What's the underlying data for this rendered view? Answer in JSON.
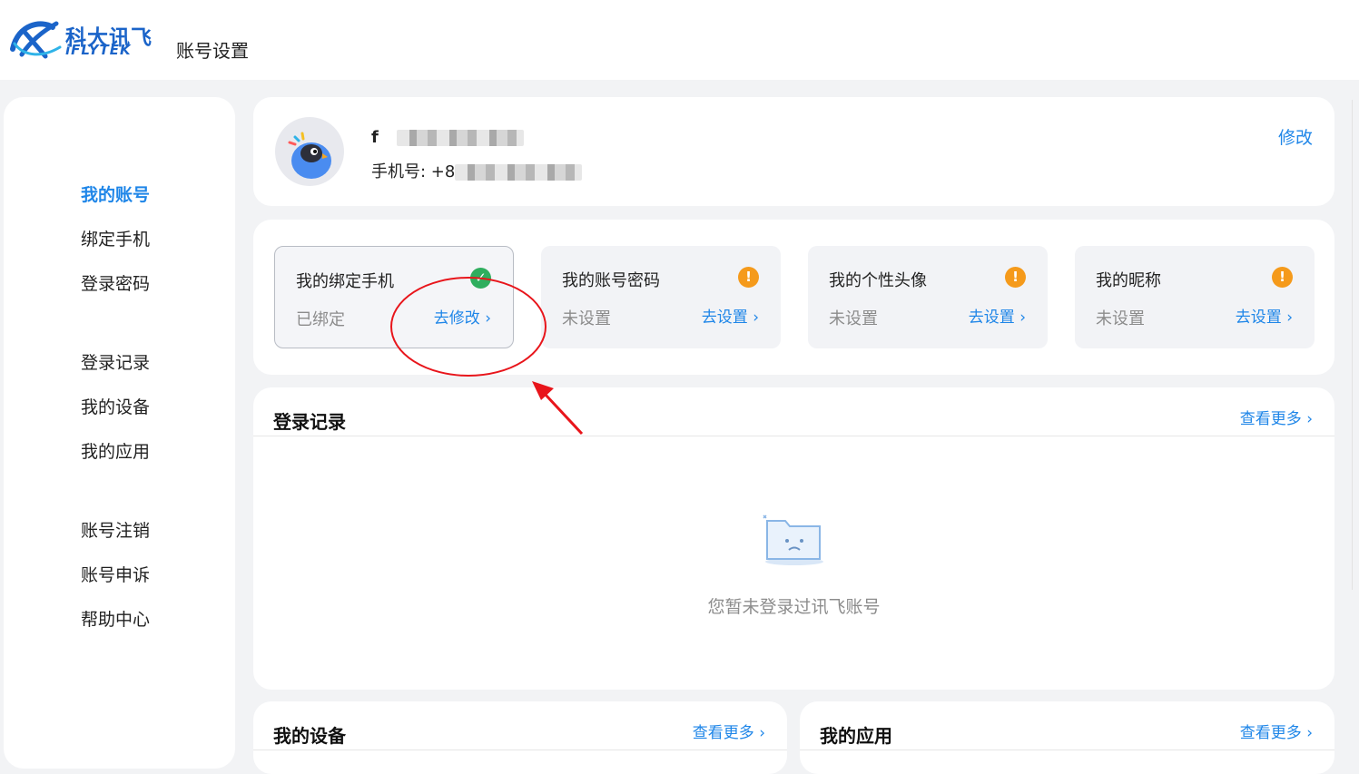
{
  "header": {
    "logo_cn": "科大讯飞",
    "logo_en": "iFLYTEK",
    "title": "账号设置"
  },
  "sidebar": {
    "items": [
      {
        "label": "我的账号",
        "active": true
      },
      {
        "label": "绑定手机"
      },
      {
        "label": "登录密码"
      },
      {
        "label": "登录记录"
      },
      {
        "label": "我的设备"
      },
      {
        "label": "我的应用"
      },
      {
        "label": "账号注销"
      },
      {
        "label": "账号申诉"
      },
      {
        "label": "帮助中心"
      }
    ]
  },
  "profile": {
    "name_prefix": "f",
    "phone_label": "手机号: +8",
    "edit_label": "修改"
  },
  "bindings": [
    {
      "title": "我的绑定手机",
      "status": "已绑定",
      "action": "去修改 ›",
      "state": "ok",
      "icon": "check-icon"
    },
    {
      "title": "我的账号密码",
      "status": "未设置",
      "action": "去设置 ›",
      "state": "warn",
      "icon": "warning-icon"
    },
    {
      "title": "我的个性头像",
      "status": "未设置",
      "action": "去设置 ›",
      "state": "warn",
      "icon": "warning-icon"
    },
    {
      "title": "我的昵称",
      "status": "未设置",
      "action": "去设置 ›",
      "state": "warn",
      "icon": "warning-icon"
    }
  ],
  "login_records": {
    "title": "登录记录",
    "more": "查看更多 ›",
    "empty": "您暂未登录过讯飞账号"
  },
  "devices": {
    "title": "我的设备",
    "more": "查看更多 ›"
  },
  "apps": {
    "title": "我的应用",
    "more": "查看更多 ›"
  },
  "colors": {
    "accent": "#1f86e8",
    "ok": "#2fae5e",
    "warn": "#f59a1b",
    "annotation": "#e8151b"
  }
}
